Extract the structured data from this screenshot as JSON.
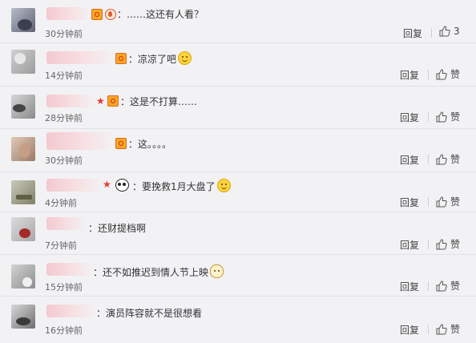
{
  "comments": [
    {
      "text": "：……这还有人看？",
      "time": "30分钟前",
      "reply": "回复",
      "like": "3",
      "badges": [
        "vip",
        "flame"
      ],
      "emoji": null
    },
    {
      "text": "：凉凉了吧",
      "time": "14分钟前",
      "reply": "回复",
      "like": "赞",
      "badges": [
        "vip"
      ],
      "emoji": "grin"
    },
    {
      "text": "：这是不打算……",
      "time": "28分钟前",
      "reply": "回复",
      "like": "赞",
      "badges": [
        "star",
        "vip"
      ],
      "emoji": null
    },
    {
      "text": "：这。。。。",
      "time": "30分钟前",
      "reply": "回复",
      "like": "赞",
      "badges": [
        "vip"
      ],
      "emoji": null
    },
    {
      "text": "：要挽救1月大盘了",
      "time": "4分钟前",
      "reply": "回复",
      "like": "赞",
      "badges": [
        "star",
        "panda"
      ],
      "emoji": "smile"
    },
    {
      "text": "：还财提档啊",
      "time": "7分钟前",
      "reply": "回复",
      "like": "赞",
      "badges": [],
      "emoji": null
    },
    {
      "text": "：还不如推迟到情人节上映",
      "time": "15分钟前",
      "reply": "回复",
      "like": "赞",
      "badges": [],
      "emoji": "cat"
    },
    {
      "text": "：演员阵容就不是很想看",
      "time": "16分钟前",
      "reply": "回复",
      "like": "赞",
      "badges": [],
      "emoji": null
    }
  ],
  "icons": {
    "like": "thumbs-up-icon"
  },
  "colors": {
    "background": "#f2f2f5",
    "text": "#333333",
    "meta": "#666666"
  }
}
